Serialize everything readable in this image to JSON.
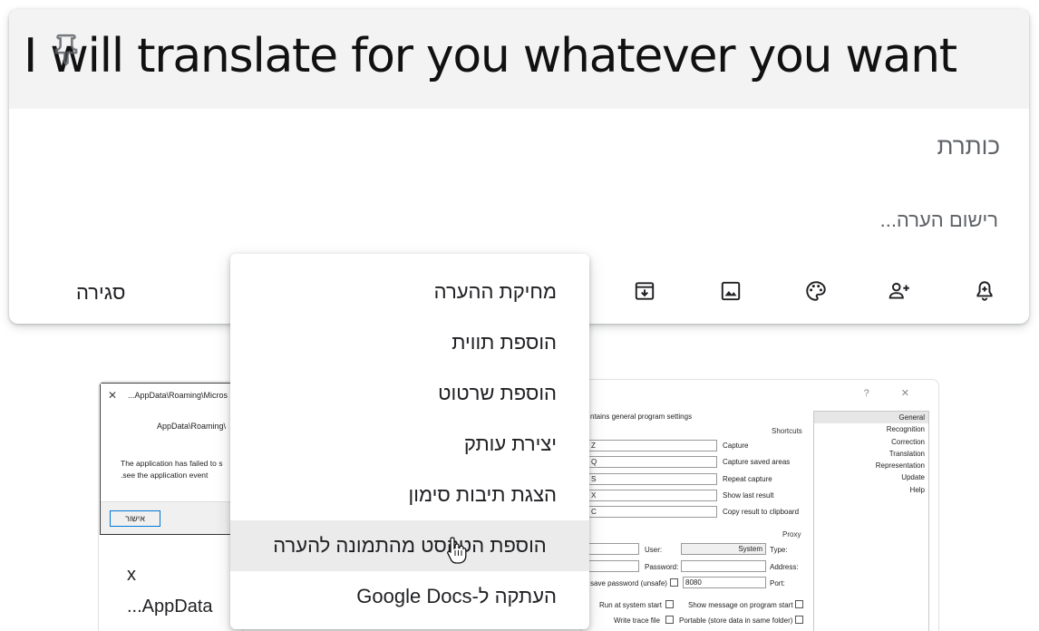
{
  "note": {
    "image_text": "I will translate for you whatever you want",
    "title_placeholder": "כותרת",
    "body_placeholder": "רישום הערה...",
    "close_label": "סגירה",
    "toolbar_icons": [
      "add-alert-icon",
      "add-collaborator-icon",
      "palette-icon",
      "add-image-icon",
      "archive-icon"
    ]
  },
  "context_menu": {
    "items": [
      {
        "label": "מחיקת ההערה"
      },
      {
        "label": "הוספת תווית"
      },
      {
        "label": "הוספת שרטוט"
      },
      {
        "label": "יצירת עותק"
      },
      {
        "label": "הצגת תיבות סימון"
      },
      {
        "label": "הוספת הטקסט מהתמונה להערה",
        "hovered": true
      },
      {
        "label": "העתקה ל-Google Docs"
      }
    ]
  },
  "background_notes": {
    "error_note": {
      "window_title": "...AppData\\Roaming\\Micros",
      "path_text": "AppData\\Roaming\\",
      "message_line1": "The application has failed to s",
      "message_line2": ".see the application event",
      "ok_label": "אישור",
      "title_text": "x",
      "body_text": "...AppData"
    },
    "settings_note": {
      "description": "ntains general program settings",
      "window_icons": "? ✕",
      "categories": [
        "General",
        "Recognition",
        "Correction",
        "Translation",
        "Representation",
        "Update",
        "Help"
      ],
      "shortcuts_heading": "Shortcuts",
      "shortcuts": [
        {
          "key": "Z",
          "label": "Capture"
        },
        {
          "key": "Q",
          "label": "Capture saved areas"
        },
        {
          "key": "S",
          "label": "Repeat capture"
        },
        {
          "key": "X",
          "label": "Show last result"
        },
        {
          "key": "C",
          "label": "Copy result to clipboard"
        }
      ],
      "proxy_heading": "Proxy",
      "proxy_user_label": "User:",
      "proxy_type_label": "Type:",
      "proxy_type_value": "System",
      "proxy_password_label": "Password:",
      "proxy_address_label": "Address:",
      "proxy_save_label": "save password (unsafe)",
      "proxy_port_label": "Port:",
      "proxy_port_value": "8080",
      "run_at_start_label": "Run at system start",
      "show_message_label": "Show message on program start",
      "write_trace_label": "Write trace file",
      "portable_label": "Portable (store data in same folder)"
    }
  }
}
